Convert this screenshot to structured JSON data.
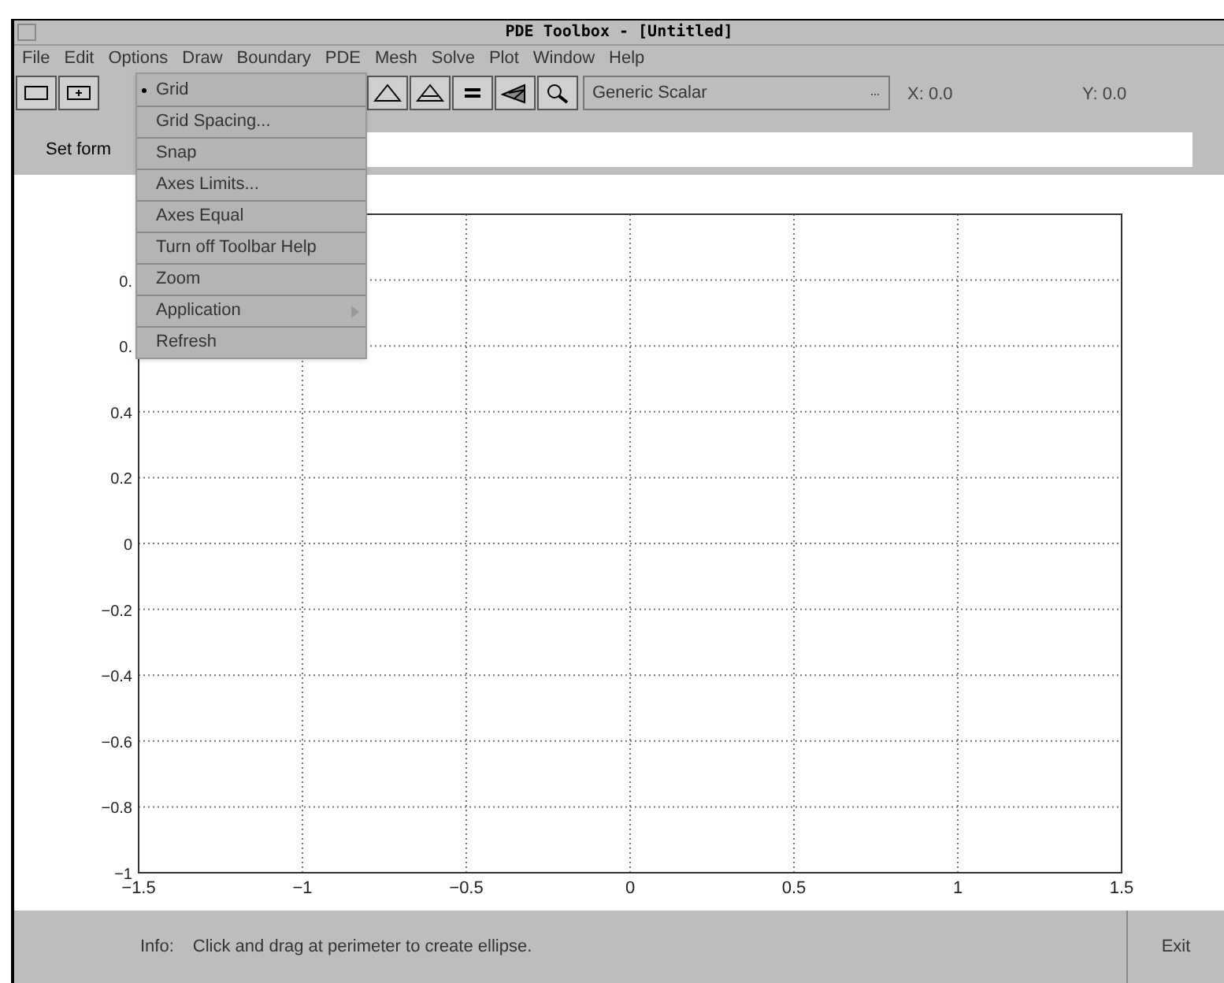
{
  "window": {
    "title": "PDE Toolbox - [Untitled]"
  },
  "menu_bar": [
    "File",
    "Edit",
    "Options",
    "Draw",
    "Boundary",
    "PDE",
    "Mesh",
    "Solve",
    "Plot",
    "Window",
    "Help"
  ],
  "options_menu": [
    {
      "label": "Grid",
      "checked": true,
      "kind": "item"
    },
    {
      "label": "Grid Spacing...",
      "checked": false,
      "kind": "item"
    },
    {
      "label": "Snap",
      "checked": false,
      "kind": "item"
    },
    {
      "label": "Axes Limits...",
      "checked": false,
      "kind": "item"
    },
    {
      "label": "Axes Equal",
      "checked": false,
      "kind": "item"
    },
    {
      "label": "Turn off Toolbar Help",
      "checked": false,
      "kind": "item"
    },
    {
      "label": "Zoom",
      "checked": false,
      "kind": "item"
    },
    {
      "label": "Application",
      "checked": false,
      "kind": "submenu"
    },
    {
      "label": "Refresh",
      "checked": false,
      "kind": "item"
    }
  ],
  "toolbar": {
    "application": "Generic Scalar",
    "x_readout": "X: 0.0",
    "y_readout": "Y: 0.0"
  },
  "formula_row": {
    "label": "Set form"
  },
  "plot": {
    "y_ticks": [
      "0.",
      "0.",
      "0.4",
      "0.2",
      "0",
      "−0.2",
      "−0.4",
      "−0.6",
      "−0.8",
      "−1"
    ],
    "x_ticks": [
      "−1.5",
      "−1",
      "−0.5",
      "0",
      "0.5",
      "1",
      "1.5"
    ]
  },
  "status_bar": {
    "label": "Info:",
    "message": "Click and drag at perimeter to create ellipse.",
    "exit_button": "Exit"
  }
}
